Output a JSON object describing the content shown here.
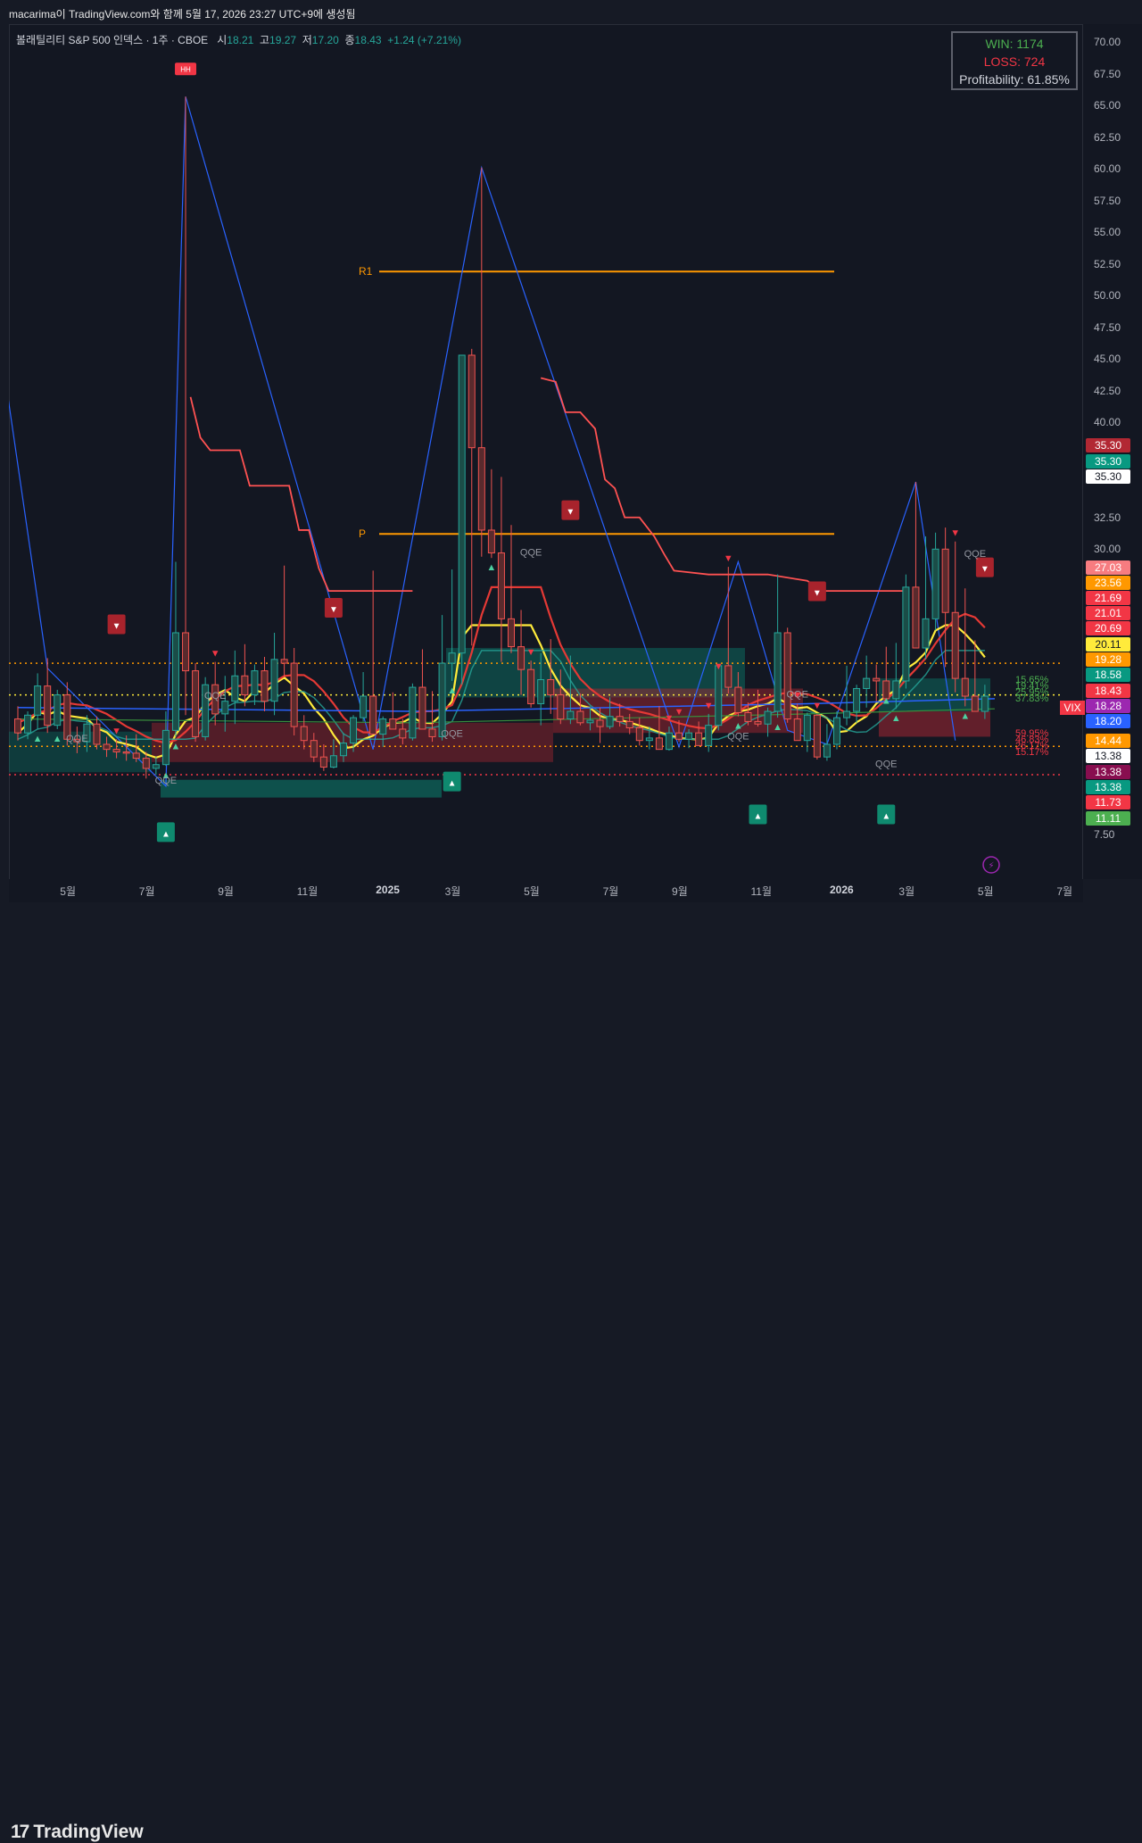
{
  "header": {
    "snapshot_note": "macarima이 TradingView.com와 함께 5월 17, 2026 23:27 UTC+9에 생성됨"
  },
  "legend": {
    "symbol": "볼래틸리티 S&P 500 인덱스 · 1주 · CBOE",
    "open_label": "시",
    "open": "18.21",
    "high_label": "고",
    "high": "19.27",
    "low_label": "저",
    "low": "17.20",
    "close_label": "종",
    "close": "18.43",
    "change": "+1.24 (+7.21%)"
  },
  "winloss": {
    "win": "WIN: 1174",
    "loss": "LOSS: 724",
    "profitability": "Profitability: 61.85%"
  },
  "toolbar": {
    "point_label": "point"
  },
  "footer": {
    "brand": "TradingView",
    "brand_mark": "17"
  },
  "colors": {
    "bg": "#131722",
    "up": "#26a69a",
    "down": "#ef5350",
    "level": "#ff9800",
    "wave": "#2962ff"
  },
  "icons": {
    "arrow_up": "▲",
    "arrow_down": "▼",
    "lightning": "⚡"
  },
  "chart_data": {
    "type": "candlestick",
    "symbol": "VIX",
    "timeframe": "1주",
    "ylim": [
      6.5,
      71
    ],
    "y_ticks": [
      "70.00",
      "67.50",
      "65.00",
      "62.50",
      "60.00",
      "57.50",
      "55.00",
      "52.50",
      "50.00",
      "47.50",
      "45.00",
      "42.50",
      "40.00",
      "32.50",
      "30.00",
      "7.50"
    ],
    "x_ticks": [
      {
        "label": "5월",
        "i": 5
      },
      {
        "label": "7월",
        "i": 13
      },
      {
        "label": "9월",
        "i": 21
      },
      {
        "label": "11월",
        "i": 29
      },
      {
        "label": "2025",
        "i": 37,
        "bold": true
      },
      {
        "label": "3월",
        "i": 44
      },
      {
        "label": "5월",
        "i": 52
      },
      {
        "label": "7월",
        "i": 60
      },
      {
        "label": "9월",
        "i": 67
      },
      {
        "label": "11월",
        "i": 75
      },
      {
        "label": "2026",
        "i": 83,
        "bold": true
      },
      {
        "label": "3월",
        "i": 90
      },
      {
        "label": "5월",
        "i": 98
      },
      {
        "label": "7월",
        "i": 106
      }
    ],
    "candles": [
      [
        16.6,
        17.6,
        14.9,
        15.5
      ],
      [
        15.5,
        17.2,
        15.0,
        16.9
      ],
      [
        16.9,
        20.2,
        15.8,
        19.2
      ],
      [
        19.2,
        21.4,
        15.5,
        16.1
      ],
      [
        16.1,
        18.9,
        15.8,
        18.5
      ],
      [
        18.5,
        19.5,
        14.5,
        15.0
      ],
      [
        15.0,
        16.0,
        13.9,
        14.8
      ],
      [
        14.8,
        16.9,
        14.0,
        16.2
      ],
      [
        16.2,
        16.8,
        14.2,
        14.6
      ],
      [
        14.6,
        15.2,
        13.6,
        14.2
      ],
      [
        14.2,
        15.0,
        13.5,
        14.0
      ],
      [
        14.0,
        15.3,
        13.3,
        13.9
      ],
      [
        13.9,
        15.4,
        13.2,
        13.5
      ],
      [
        13.5,
        14.0,
        11.9,
        12.7
      ],
      [
        12.7,
        13.6,
        12.2,
        13.0
      ],
      [
        13.0,
        17.2,
        12.9,
        15.7
      ],
      [
        15.7,
        29.0,
        15.2,
        23.4
      ],
      [
        23.4,
        65.7,
        16.9,
        20.4
      ],
      [
        20.4,
        21.0,
        14.8,
        15.2
      ],
      [
        15.2,
        19.9,
        14.9,
        19.3
      ],
      [
        19.3,
        21.1,
        16.1,
        17.0
      ],
      [
        17.0,
        20.0,
        15.6,
        18.0
      ],
      [
        18.0,
        22.0,
        16.2,
        20.0
      ],
      [
        20.0,
        22.5,
        17.6,
        18.5
      ],
      [
        18.5,
        20.9,
        17.7,
        20.4
      ],
      [
        20.4,
        21.5,
        17.2,
        18.0
      ],
      [
        18.0,
        23.4,
        16.9,
        21.3
      ],
      [
        21.3,
        28.7,
        19.9,
        21.0
      ],
      [
        21.0,
        22.2,
        15.3,
        16.0
      ],
      [
        16.0,
        16.9,
        14.2,
        14.9
      ],
      [
        14.9,
        15.5,
        13.2,
        13.6
      ],
      [
        13.6,
        14.6,
        12.5,
        12.8
      ],
      [
        12.8,
        15.0,
        12.7,
        13.7
      ],
      [
        13.7,
        15.5,
        13.2,
        14.7
      ],
      [
        14.7,
        16.9,
        14.0,
        16.7
      ],
      [
        16.7,
        20.3,
        16.4,
        18.4
      ],
      [
        18.4,
        28.3,
        17.5,
        15.4
      ],
      [
        15.4,
        16.8,
        14.4,
        16.6
      ],
      [
        16.6,
        18.7,
        15.9,
        15.8
      ],
      [
        15.8,
        16.6,
        14.6,
        15.1
      ],
      [
        15.1,
        19.4,
        14.9,
        19.1
      ],
      [
        19.1,
        22.1,
        15.8,
        15.8
      ],
      [
        15.8,
        18.8,
        14.8,
        15.2
      ],
      [
        15.2,
        24.8,
        14.9,
        21.0
      ],
      [
        21.0,
        28.4,
        19.6,
        21.8
      ],
      [
        21.8,
        27.9,
        19.3,
        45.3
      ],
      [
        45.3,
        45.8,
        22.4,
        38.0
      ],
      [
        38.0,
        60.1,
        29.4,
        31.5
      ],
      [
        31.5,
        36.3,
        29.3,
        29.7
      ],
      [
        29.7,
        35.7,
        21.1,
        24.5
      ],
      [
        24.5,
        31.9,
        21.8,
        22.3
      ],
      [
        22.3,
        25.2,
        18.5,
        20.5
      ],
      [
        20.5,
        21.2,
        17.5,
        17.8
      ],
      [
        17.8,
        21.8,
        16.1,
        19.7
      ],
      [
        19.7,
        22.9,
        17.0,
        18.5
      ],
      [
        18.5,
        20.5,
        16.2,
        16.6
      ],
      [
        16.6,
        21.6,
        16.2,
        17.2
      ],
      [
        17.2,
        18.6,
        16.1,
        16.3
      ],
      [
        16.3,
        17.6,
        15.7,
        16.5
      ],
      [
        16.5,
        17.5,
        14.7,
        16.0
      ],
      [
        16.0,
        18.3,
        15.8,
        16.8
      ],
      [
        16.8,
        17.8,
        16.0,
        16.4
      ],
      [
        16.4,
        17.0,
        15.4,
        15.9
      ],
      [
        15.9,
        16.7,
        14.5,
        14.9
      ],
      [
        14.9,
        16.0,
        14.2,
        15.1
      ],
      [
        15.1,
        17.6,
        14.6,
        14.2
      ],
      [
        14.2,
        16.0,
        14.1,
        15.5
      ],
      [
        15.5,
        16.5,
        14.8,
        15.0
      ],
      [
        15.0,
        15.8,
        14.3,
        15.5
      ],
      [
        15.5,
        16.4,
        15.0,
        14.5
      ],
      [
        14.5,
        17.0,
        14.0,
        16.1
      ],
      [
        16.1,
        20.1,
        15.7,
        20.8
      ],
      [
        20.8,
        28.6,
        18.6,
        19.1
      ],
      [
        19.1,
        20.3,
        16.8,
        17.1
      ],
      [
        17.1,
        17.9,
        16.1,
        16.4
      ],
      [
        16.4,
        18.9,
        16.0,
        16.2
      ],
      [
        16.2,
        17.5,
        15.2,
        17.2
      ],
      [
        17.2,
        28.0,
        16.7,
        23.4
      ],
      [
        23.4,
        23.8,
        16.3,
        16.6
      ],
      [
        16.6,
        17.8,
        15.7,
        14.9
      ],
      [
        14.9,
        17.1,
        14.0,
        16.9
      ],
      [
        16.9,
        17.0,
        13.4,
        13.6
      ],
      [
        13.6,
        16.2,
        13.3,
        14.6
      ],
      [
        14.6,
        17.2,
        14.2,
        16.7
      ],
      [
        16.7,
        20.8,
        16.1,
        17.2
      ],
      [
        17.2,
        19.3,
        16.3,
        19.0
      ],
      [
        19.0,
        21.6,
        17.5,
        19.8
      ],
      [
        19.8,
        20.9,
        18.0,
        19.6
      ],
      [
        19.6,
        22.3,
        18.8,
        18.2
      ],
      [
        18.2,
        22.6,
        17.4,
        19.6
      ],
      [
        19.6,
        28.0,
        19.0,
        27.0
      ],
      [
        27.0,
        35.3,
        22.9,
        22.2
      ],
      [
        22.2,
        31.0,
        21.3,
        24.5
      ],
      [
        24.5,
        31.3,
        23.6,
        30.0
      ],
      [
        30.0,
        31.7,
        20.7,
        25.0
      ],
      [
        25.0,
        30.6,
        18.7,
        19.8
      ],
      [
        19.8,
        26.9,
        17.6,
        18.4
      ],
      [
        18.4,
        22.8,
        17.4,
        17.2
      ],
      [
        17.2,
        19.3,
        16.6,
        18.4
      ]
    ],
    "annotations": [
      {
        "type": "level",
        "label": "R1",
        "value": 51.9
      },
      {
        "type": "level",
        "label": "P",
        "value": 31.2
      },
      {
        "type": "label",
        "text": "HH"
      },
      {
        "type": "label",
        "text": "QQE"
      }
    ],
    "price_tags": [
      {
        "value": "35.30",
        "bg": "#b22833",
        "fg": "#ffffff"
      },
      {
        "value": "35.30",
        "bg": "#089981",
        "fg": "#ffffff"
      },
      {
        "value": "35.30",
        "bg": "#ffffff",
        "fg": "#131722"
      },
      {
        "value": "27.03",
        "bg": "#f77c80",
        "fg": "#ffffff"
      },
      {
        "value": "23.56",
        "bg": "#ff9800",
        "fg": "#ffffff"
      },
      {
        "value": "21.69",
        "bg": "#f23645",
        "fg": "#ffffff"
      },
      {
        "value": "21.01",
        "bg": "#f23645",
        "fg": "#ffffff"
      },
      {
        "value": "20.69",
        "bg": "#f23645",
        "fg": "#ffffff"
      },
      {
        "value": "20.11",
        "bg": "#ffeb3b",
        "fg": "#131722"
      },
      {
        "value": "19.28",
        "bg": "#ff9800",
        "fg": "#ffffff"
      },
      {
        "value": "18.58",
        "bg": "#089981",
        "fg": "#ffffff"
      },
      {
        "value": "18.43",
        "bg": "#f23645",
        "fg": "#ffffff"
      },
      {
        "value": "18.28",
        "bg": "#9c27b0",
        "fg": "#ffffff"
      },
      {
        "value": "18.20",
        "bg": "#2962ff",
        "fg": "#ffffff"
      },
      {
        "value": "14.44",
        "bg": "#ff9800",
        "fg": "#ffffff"
      },
      {
        "value": "13.38",
        "bg": "#ffffff",
        "fg": "#131722"
      },
      {
        "value": "13.38",
        "bg": "#880e4f",
        "fg": "#ffffff"
      },
      {
        "value": "13.38",
        "bg": "#089981",
        "fg": "#ffffff"
      },
      {
        "value": "11.73",
        "bg": "#f23645",
        "fg": "#ffffff"
      },
      {
        "value": "11.11",
        "bg": "#4caf50",
        "fg": "#ffffff"
      }
    ],
    "vix_label": "VIX",
    "right_pct_labels": [
      "15.65%",
      "19.41%",
      "25.95%",
      "37.83%",
      "59.95%",
      "46.83%",
      "26.17%",
      "15.17%"
    ]
  }
}
